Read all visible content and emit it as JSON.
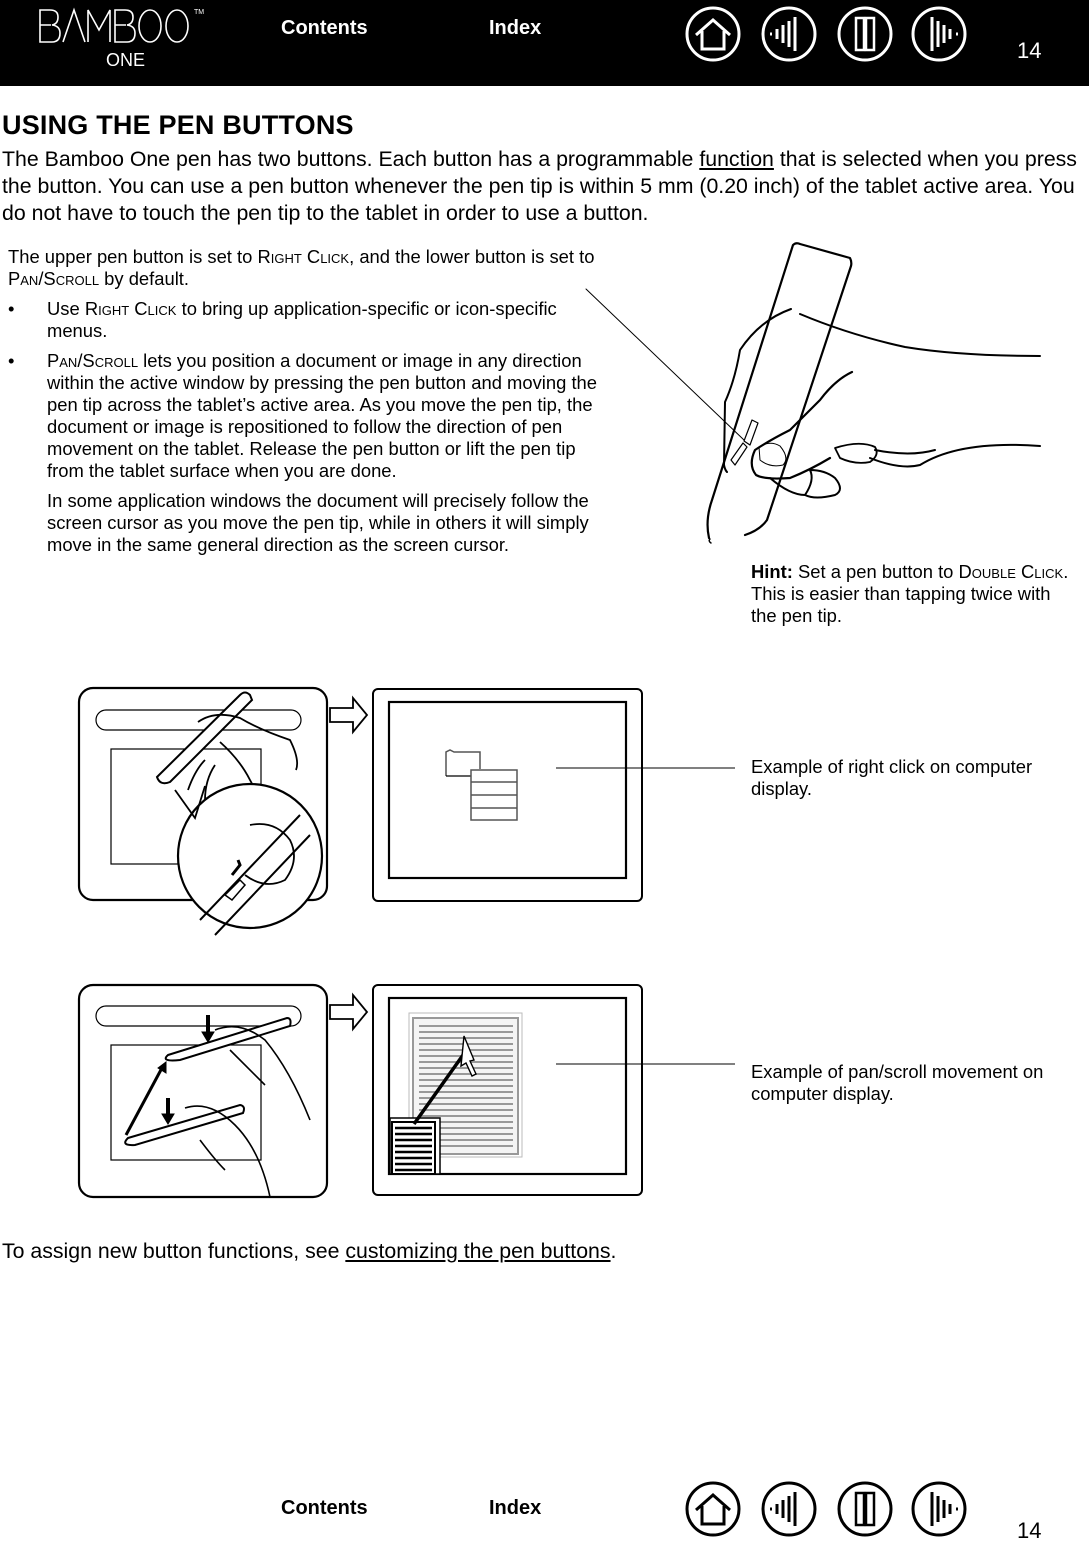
{
  "header": {
    "logo_text": "BAMBOO",
    "logo_tm": "TM",
    "logo_sub": "ONE",
    "contents_label": "Contents",
    "index_label": "Index",
    "icons": [
      "home-icon",
      "previous-page-icon",
      "book-icon",
      "next-page-icon"
    ],
    "page_number": "14"
  },
  "main": {
    "title": "USING THE PEN BUTTONS",
    "intro_before": "The Bamboo One pen has two buttons.  Each button has a programmable ",
    "intro_link": "function",
    "intro_after": " that is selected when you press the button.  You can use a pen button whenever the pen tip is within 5 mm (0.20 inch) of the tablet active area.  You do not have to touch the pen tip to the tablet in order to use a button.",
    "defaults": {
      "p1": "The upper pen button is set to ",
      "right_click": "Right Click",
      "p2": ", and the lower button is set to ",
      "pan_scroll": "Pan/Scroll",
      "p3": " by default."
    },
    "bullets": [
      {
        "marker": "•",
        "term": "Right Click",
        "text": " to bring up application-specific or icon-specific menus.",
        "prefix": "Use "
      },
      {
        "marker": "•",
        "term": "Pan/Scroll",
        "text": " lets you position a document or image in any direction within the active window by pressing the pen button and moving the pen tip across the tablet’s active area.  As you move the pen tip, the document or image is repositioned to follow the direction of pen movement on the tablet.  Release the pen button or lift the pen tip from the tablet surface when you are done.",
        "prefix": ""
      }
    ],
    "pan_note": "In some application windows the document will precisely follow the screen cursor as you move the pen tip, while in others it will simply move in the same general direction as the screen cursor.",
    "hint": {
      "label": "Hint:",
      "text1": " Set a pen button to ",
      "term": "Double Click",
      "text2": ".  This is easier than tapping twice with the pen tip."
    },
    "captions": {
      "right_click": "Example of right click on computer display.",
      "pan_scroll": "Example of pan/scroll movement on computer display."
    },
    "closing_before": "To assign new button functions, see ",
    "closing_link": "customizing the pen buttons",
    "closing_after": "."
  },
  "footer": {
    "contents_label": "Contents",
    "index_label": "Index",
    "page_number": "14"
  },
  "colors": {
    "header_bg": "#000000",
    "header_text": "#ffffff",
    "body_text": "#000000"
  }
}
